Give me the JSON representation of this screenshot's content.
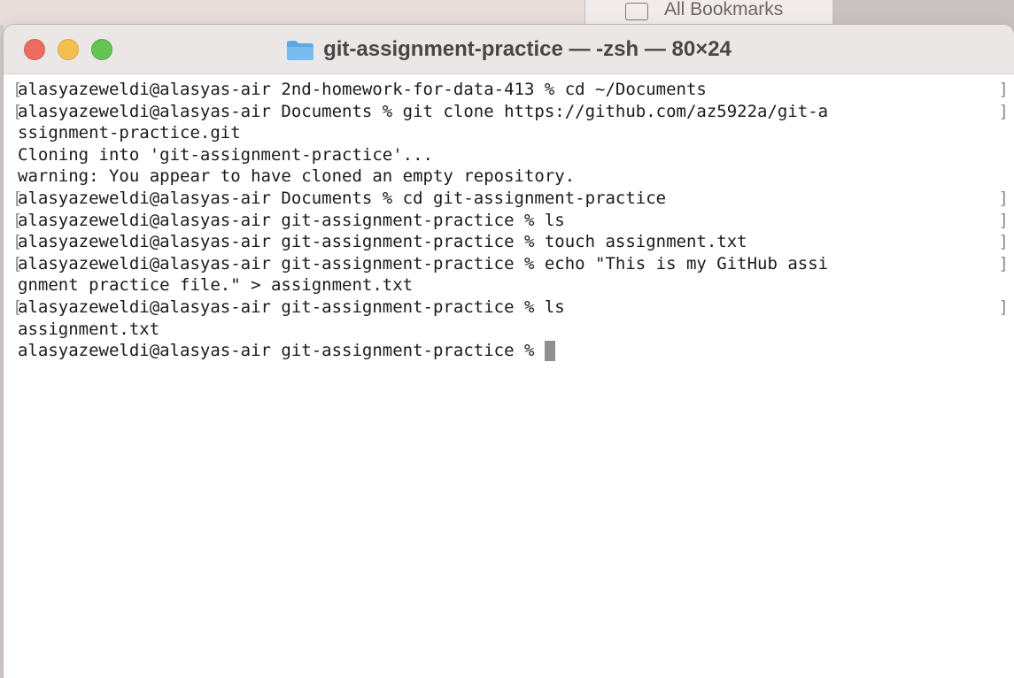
{
  "background": {
    "bookmarks_label": "All Bookmarks"
  },
  "window": {
    "title": "git-assignment-practice — -zsh — 80×24",
    "icons": {
      "close": "close-button",
      "minimize": "minimize-button",
      "zoom": "zoom-button",
      "folder": "folder-icon"
    }
  },
  "colors": {
    "close": "#ed6a5e",
    "minimize": "#f5bf4f",
    "zoom": "#62c554",
    "folder": "#5aa9e6",
    "cursor": "#8f8f8f"
  },
  "terminal": {
    "lines": [
      {
        "text": "alasyazeweldi@alasyas-air 2nd-homework-for-data-413 % cd ~/Documents",
        "left_bracket": "[",
        "right_bracket": "]"
      },
      {
        "text": "alasyazeweldi@alasyas-air Documents % git clone https://github.com/az5922a/git-a",
        "left_bracket": "[",
        "right_bracket": "]"
      },
      {
        "text": "ssignment-practice.git",
        "left_bracket": "",
        "right_bracket": ""
      },
      {
        "text": "Cloning into 'git-assignment-practice'...",
        "left_bracket": "",
        "right_bracket": ""
      },
      {
        "text": "warning: You appear to have cloned an empty repository.",
        "left_bracket": "",
        "right_bracket": ""
      },
      {
        "text": "alasyazeweldi@alasyas-air Documents % cd git-assignment-practice",
        "left_bracket": "[",
        "right_bracket": "]"
      },
      {
        "text": "alasyazeweldi@alasyas-air git-assignment-practice % ls",
        "left_bracket": "[",
        "right_bracket": "]"
      },
      {
        "text": "alasyazeweldi@alasyas-air git-assignment-practice % touch assignment.txt",
        "left_bracket": "[",
        "right_bracket": "]"
      },
      {
        "text": "alasyazeweldi@alasyas-air git-assignment-practice % echo \"This is my GitHub assi",
        "left_bracket": "[",
        "right_bracket": "]"
      },
      {
        "text": "gnment practice file.\" > assignment.txt",
        "left_bracket": "",
        "right_bracket": ""
      },
      {
        "text": "alasyazeweldi@alasyas-air git-assignment-practice % ls",
        "left_bracket": "[",
        "right_bracket": "]"
      },
      {
        "text": "assignment.txt",
        "left_bracket": "",
        "right_bracket": ""
      }
    ],
    "prompt": "alasyazeweldi@alasyas-air git-assignment-practice % "
  }
}
